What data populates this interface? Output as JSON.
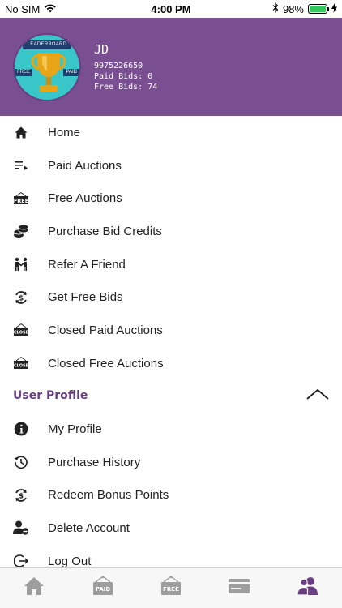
{
  "status_bar": {
    "carrier": "No SIM",
    "time": "4:00 PM",
    "battery": "98%",
    "battery_level": 0.98
  },
  "profile": {
    "name": "JD",
    "phone": "9975226650",
    "paid_bids": "Paid Bids: 0",
    "free_bids": "Free Bids: 74",
    "badge_title": "LEADERBOARD",
    "badge_free": "FREE",
    "badge_paid": "PAID"
  },
  "menu": {
    "items": [
      {
        "label": "Home",
        "icon": "home-icon"
      },
      {
        "label": "Paid Auctions",
        "icon": "list-icon"
      },
      {
        "label": "Free Auctions",
        "icon": "free-tag-icon"
      },
      {
        "label": "Purchase Bid Credits",
        "icon": "coins-icon"
      },
      {
        "label": "Refer A Friend",
        "icon": "refer-icon"
      },
      {
        "label": "Get Free Bids",
        "icon": "dollar-refresh-icon"
      },
      {
        "label": "Closed Paid Auctions",
        "icon": "close-sign-icon"
      },
      {
        "label": "Closed Free Auctions",
        "icon": "close-sign-icon"
      }
    ],
    "close_sign_text": "CLOSE",
    "free_tag_text": "FREE"
  },
  "user_profile": {
    "title": "User Profile",
    "items": [
      {
        "label": "My Profile",
        "icon": "info-icon"
      },
      {
        "label": "Purchase History",
        "icon": "history-icon"
      },
      {
        "label": "Redeem Bonus Points",
        "icon": "dollar-refresh-icon"
      },
      {
        "label": "Delete Account",
        "icon": "user-remove-icon"
      },
      {
        "label": "Log Out",
        "icon": "logout-icon"
      }
    ]
  },
  "tab_bar": {
    "paid_label": "PAID",
    "free_label": "FREE"
  },
  "colors": {
    "header_bg": "#7a4f91",
    "accent": "#6a3f82",
    "tab_icon": "#9e9e9e"
  }
}
